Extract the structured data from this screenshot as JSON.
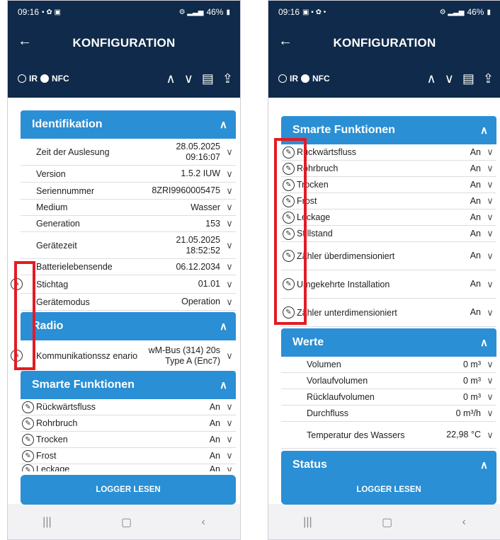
{
  "left": {
    "status": {
      "time": "09:16",
      "battery": "46%"
    },
    "title": "KONFIGURATION",
    "mode": {
      "ir": "IR",
      "nfc": "NFC"
    },
    "sections": {
      "identifikation": {
        "title": "Identifikation",
        "rows": [
          {
            "label": "Zeit der Auslesung",
            "value": "28.05.2025\n09:16:07"
          },
          {
            "label": "Version",
            "value": "1.5.2 IUW"
          },
          {
            "label": "Seriennummer",
            "value": "8ZRI9960005475"
          },
          {
            "label": "Medium",
            "value": "Wasser"
          },
          {
            "label": "Generation",
            "value": "153"
          },
          {
            "label": "Gerätezeit",
            "value": "21.05.2025\n18:52:52"
          },
          {
            "label": "Batterielebensende",
            "value": "06.12.2034"
          },
          {
            "label": "Stichtag",
            "value": "01.01"
          },
          {
            "label": "Gerätemodus",
            "value": "Operation"
          }
        ]
      },
      "radio": {
        "title": "Radio",
        "rows": [
          {
            "label": "Kommunikationssz enario",
            "value": "wM-Bus (314) 20s\nType A (Enc7)"
          }
        ]
      },
      "smart": {
        "title": "Smarte Funktionen",
        "rows": [
          {
            "label": "Rückwärtsfluss",
            "value": "An"
          },
          {
            "label": "Rohrbruch",
            "value": "An"
          },
          {
            "label": "Trocken",
            "value": "An"
          },
          {
            "label": "Frost",
            "value": "An"
          },
          {
            "label": "Leckage",
            "value": "An"
          }
        ]
      }
    },
    "button": "LOGGER LESEN"
  },
  "right": {
    "status": {
      "time": "09:16",
      "battery": "46%"
    },
    "title": "KONFIGURATION",
    "mode": {
      "ir": "IR",
      "nfc": "NFC"
    },
    "sections": {
      "smart": {
        "title": "Smarte Funktionen",
        "rows": [
          {
            "label": "Rückwärtsfluss",
            "value": "An"
          },
          {
            "label": "Rohrbruch",
            "value": "An"
          },
          {
            "label": "Trocken",
            "value": "An"
          },
          {
            "label": "Frost",
            "value": "An"
          },
          {
            "label": "Leckage",
            "value": "An"
          },
          {
            "label": "Stillstand",
            "value": "An"
          },
          {
            "label": "Zähler überdimensioniert",
            "value": "An"
          },
          {
            "label": "Umgekehrte Installation",
            "value": "An"
          },
          {
            "label": "Zähler unterdimensioniert",
            "value": "An"
          }
        ]
      },
      "werte": {
        "title": "Werte",
        "rows": [
          {
            "label": "Volumen",
            "value": "0 m³"
          },
          {
            "label": "Vorlaufvolumen",
            "value": "0 m³"
          },
          {
            "label": "Rücklaufvolumen",
            "value": "0 m³"
          },
          {
            "label": "Durchfluss",
            "value": "0 m³/h"
          },
          {
            "label": "Temperatur des Wassers",
            "value": "22,98 °C"
          }
        ]
      },
      "status": {
        "title": "Status"
      }
    },
    "button": "LOGGER LESEN"
  },
  "icons": {
    "back": "arrow-left",
    "up": "chevron-up",
    "down": "chevron-down",
    "doc": "document-icon",
    "share": "upload-icon",
    "edit": "edit-pen-icon"
  },
  "colors": {
    "appbar": "#0f2a4a",
    "accent": "#2a8fd4",
    "highlight": "#e31b23"
  }
}
